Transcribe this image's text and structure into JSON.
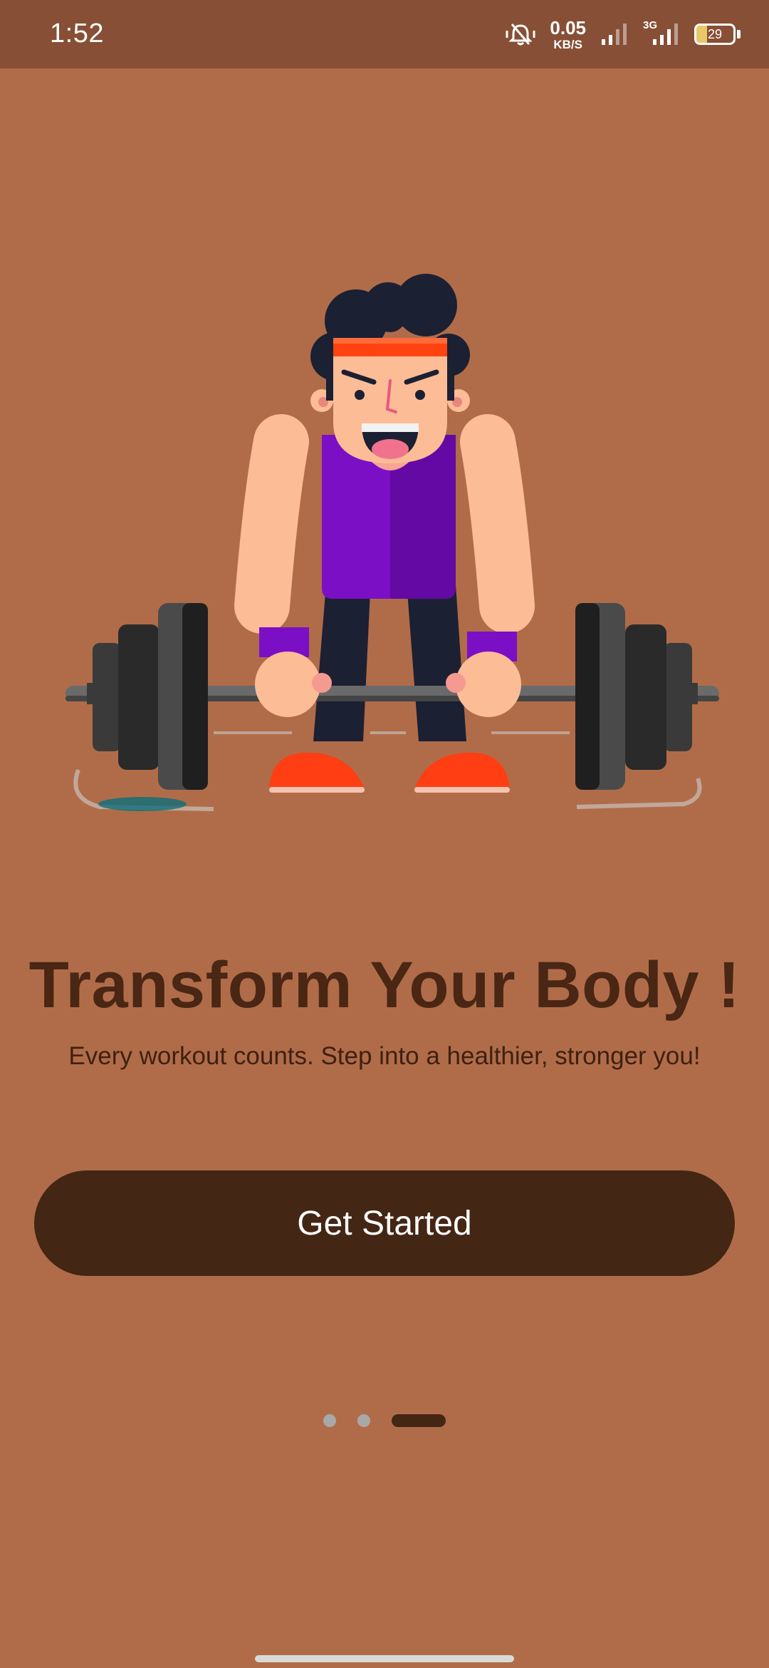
{
  "status_bar": {
    "time": "1:52",
    "net_speed_value": "0.05",
    "net_speed_unit": "KB/S",
    "network_type": "3G",
    "battery_level": "29",
    "icons": [
      "mute-vibrate-icon",
      "signal-icon",
      "signal-3g-icon",
      "battery-icon"
    ]
  },
  "onboarding": {
    "illustration": "weightlifter-illustration",
    "title": "Transform Your Body !",
    "subtitle": "Every workout counts. Step into a healthier, stronger you!",
    "cta_label": "Get Started",
    "page_count": 3,
    "active_page": 3
  },
  "colors": {
    "background": "#b06c49",
    "status_bar": "#874f35",
    "title": "#4a2614",
    "button": "#432614",
    "button_text": "#ffffff"
  }
}
